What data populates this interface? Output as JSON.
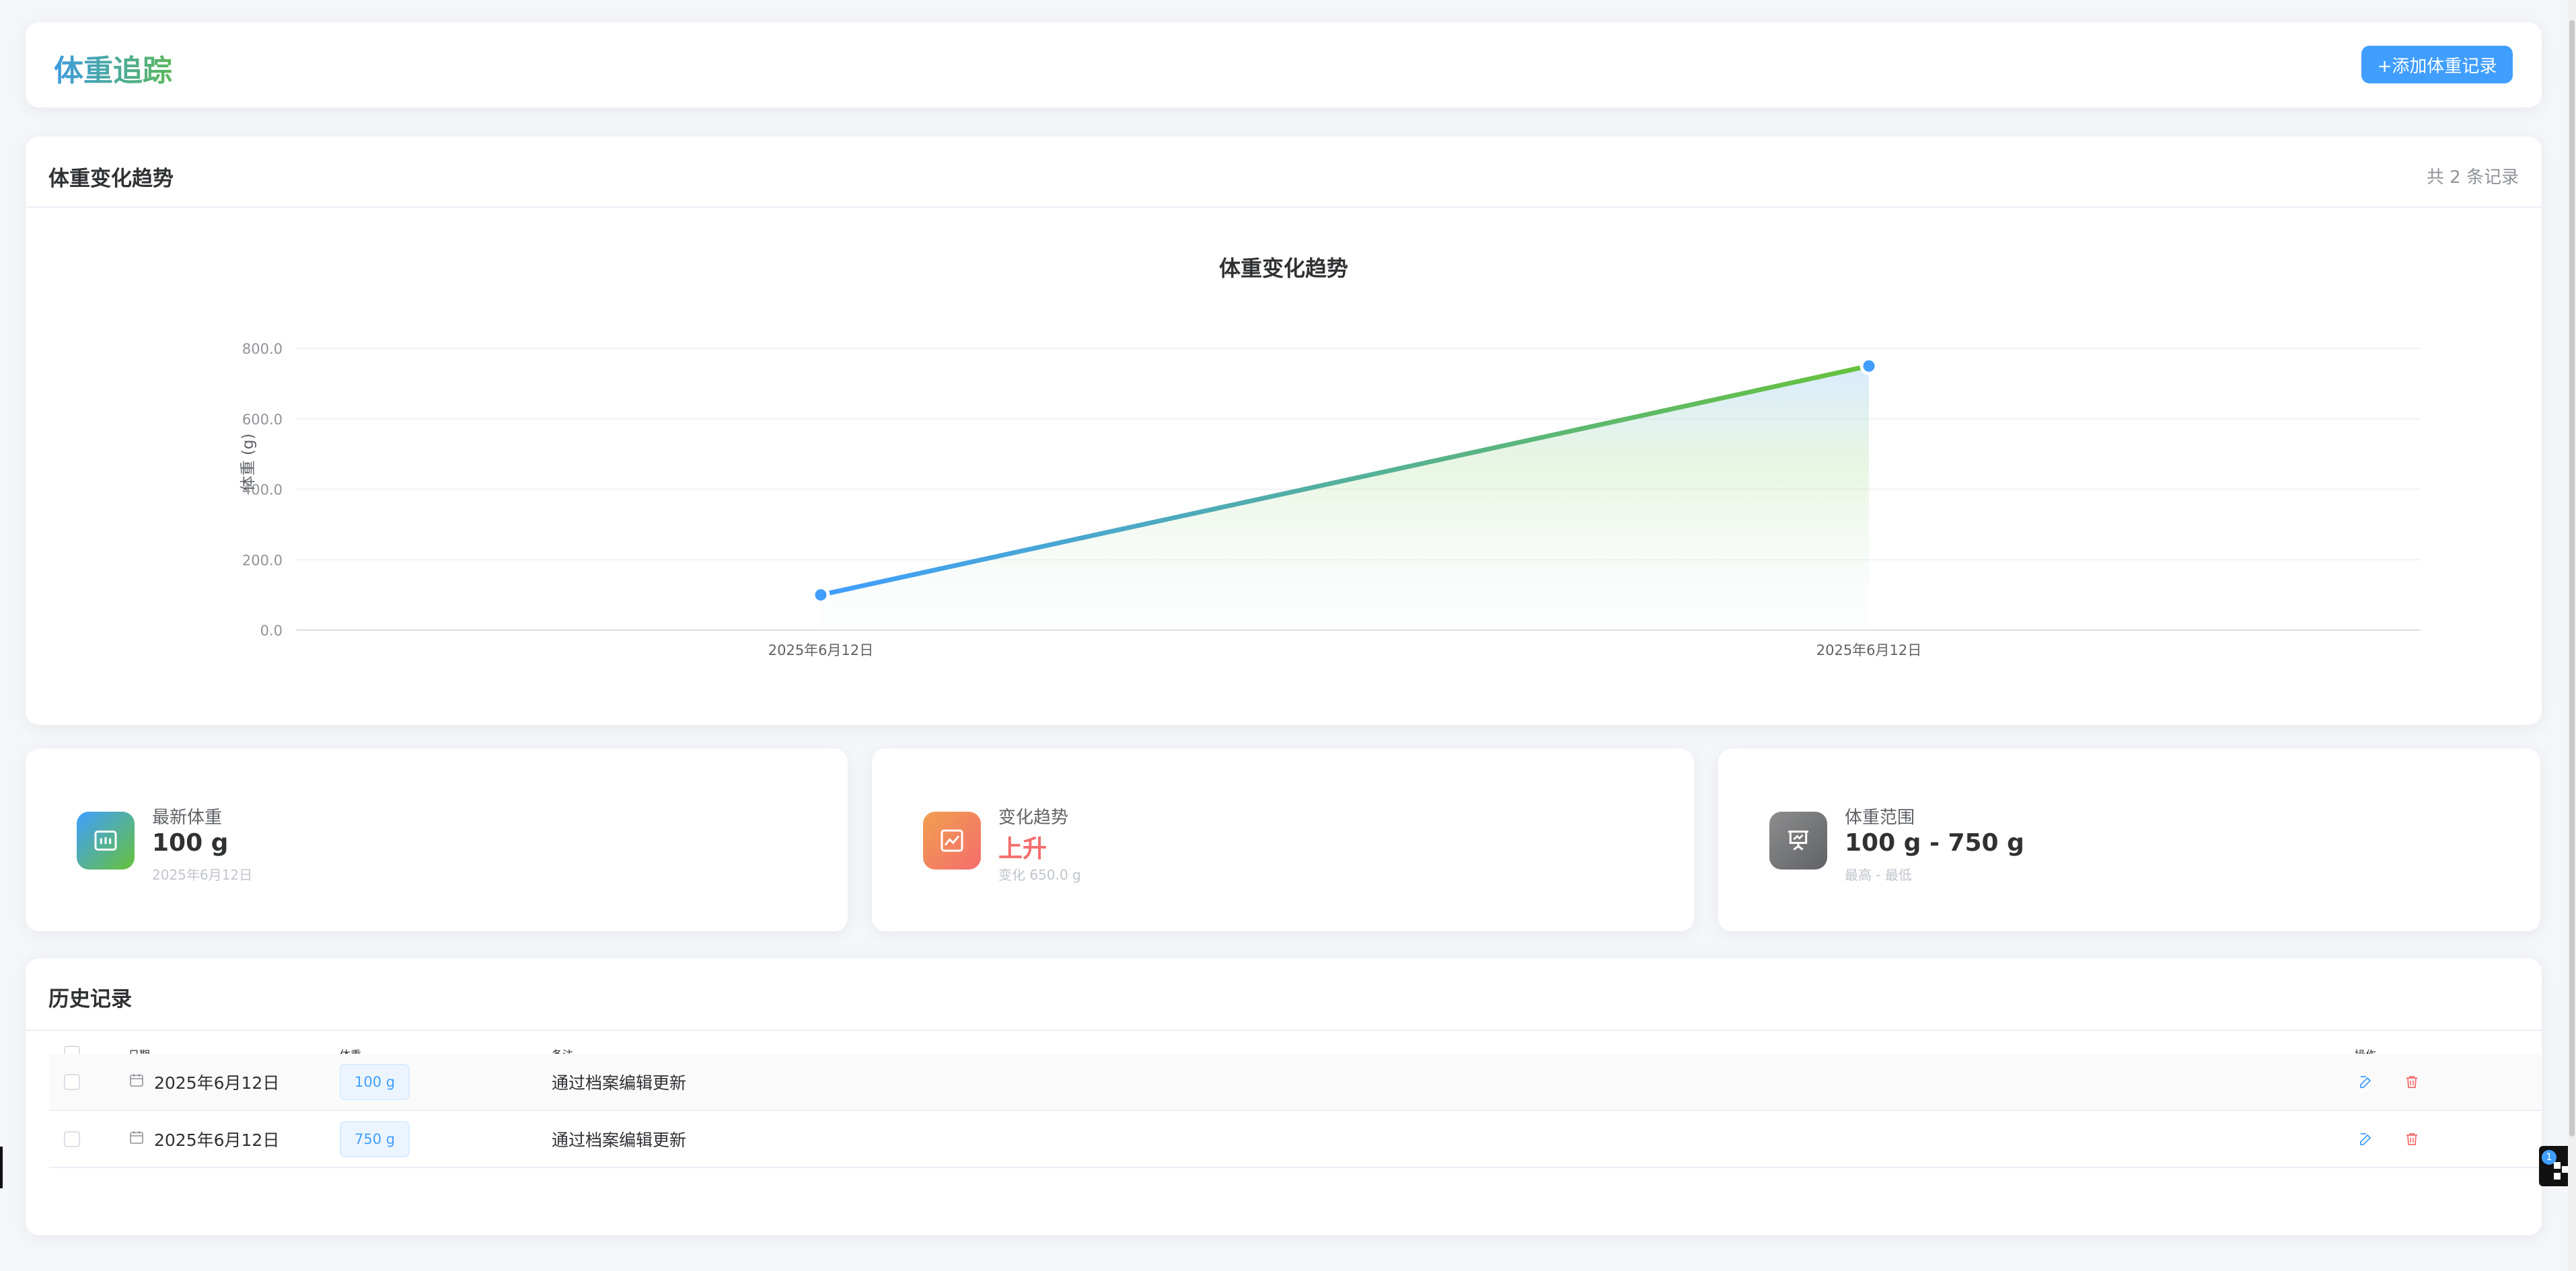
{
  "header": {
    "title": "体重追踪",
    "add_button_label": "+添加体重记录"
  },
  "chart_card": {
    "title": "体重变化趋势",
    "record_count": "共 2 条记录"
  },
  "chart_data": {
    "type": "line",
    "title": "体重变化趋势",
    "ylabel": "体重 (g)",
    "xlabel": "",
    "x": [
      "2025年6月12日",
      "2025年6月12日"
    ],
    "series": [
      {
        "values": [
          100,
          750
        ]
      }
    ],
    "ylim": [
      0,
      800
    ],
    "yticks": [
      "0.0",
      "200.0",
      "400.0",
      "600.0",
      "800.0"
    ],
    "grid": true,
    "area_fill": true,
    "colors": {
      "start": "#409eff",
      "end": "#67c23a"
    }
  },
  "stats": {
    "latest": {
      "label": "最新体重",
      "value": "100 g",
      "sub": "2025年6月12日",
      "icon": "scale-icon"
    },
    "trend": {
      "label": "变化趋势",
      "value": "上升",
      "sub": "变化 650.0 g",
      "icon": "trend-up-icon",
      "value_color": "#f56c6c"
    },
    "range": {
      "label": "体重范围",
      "value": "100 g - 750 g",
      "sub": "最高 - 最低",
      "icon": "presentation-icon"
    }
  },
  "history": {
    "title": "历史记录",
    "columns": {
      "date": "日期",
      "weight": "体重",
      "note": "备注",
      "actions": "操作"
    },
    "rows": [
      {
        "date": "2025年6月12日",
        "weight": "100 g",
        "note": "通过档案编辑更新"
      },
      {
        "date": "2025年6月12日",
        "weight": "750 g",
        "note": "通过档案编辑更新"
      }
    ]
  },
  "widget": {
    "badge": "1"
  }
}
